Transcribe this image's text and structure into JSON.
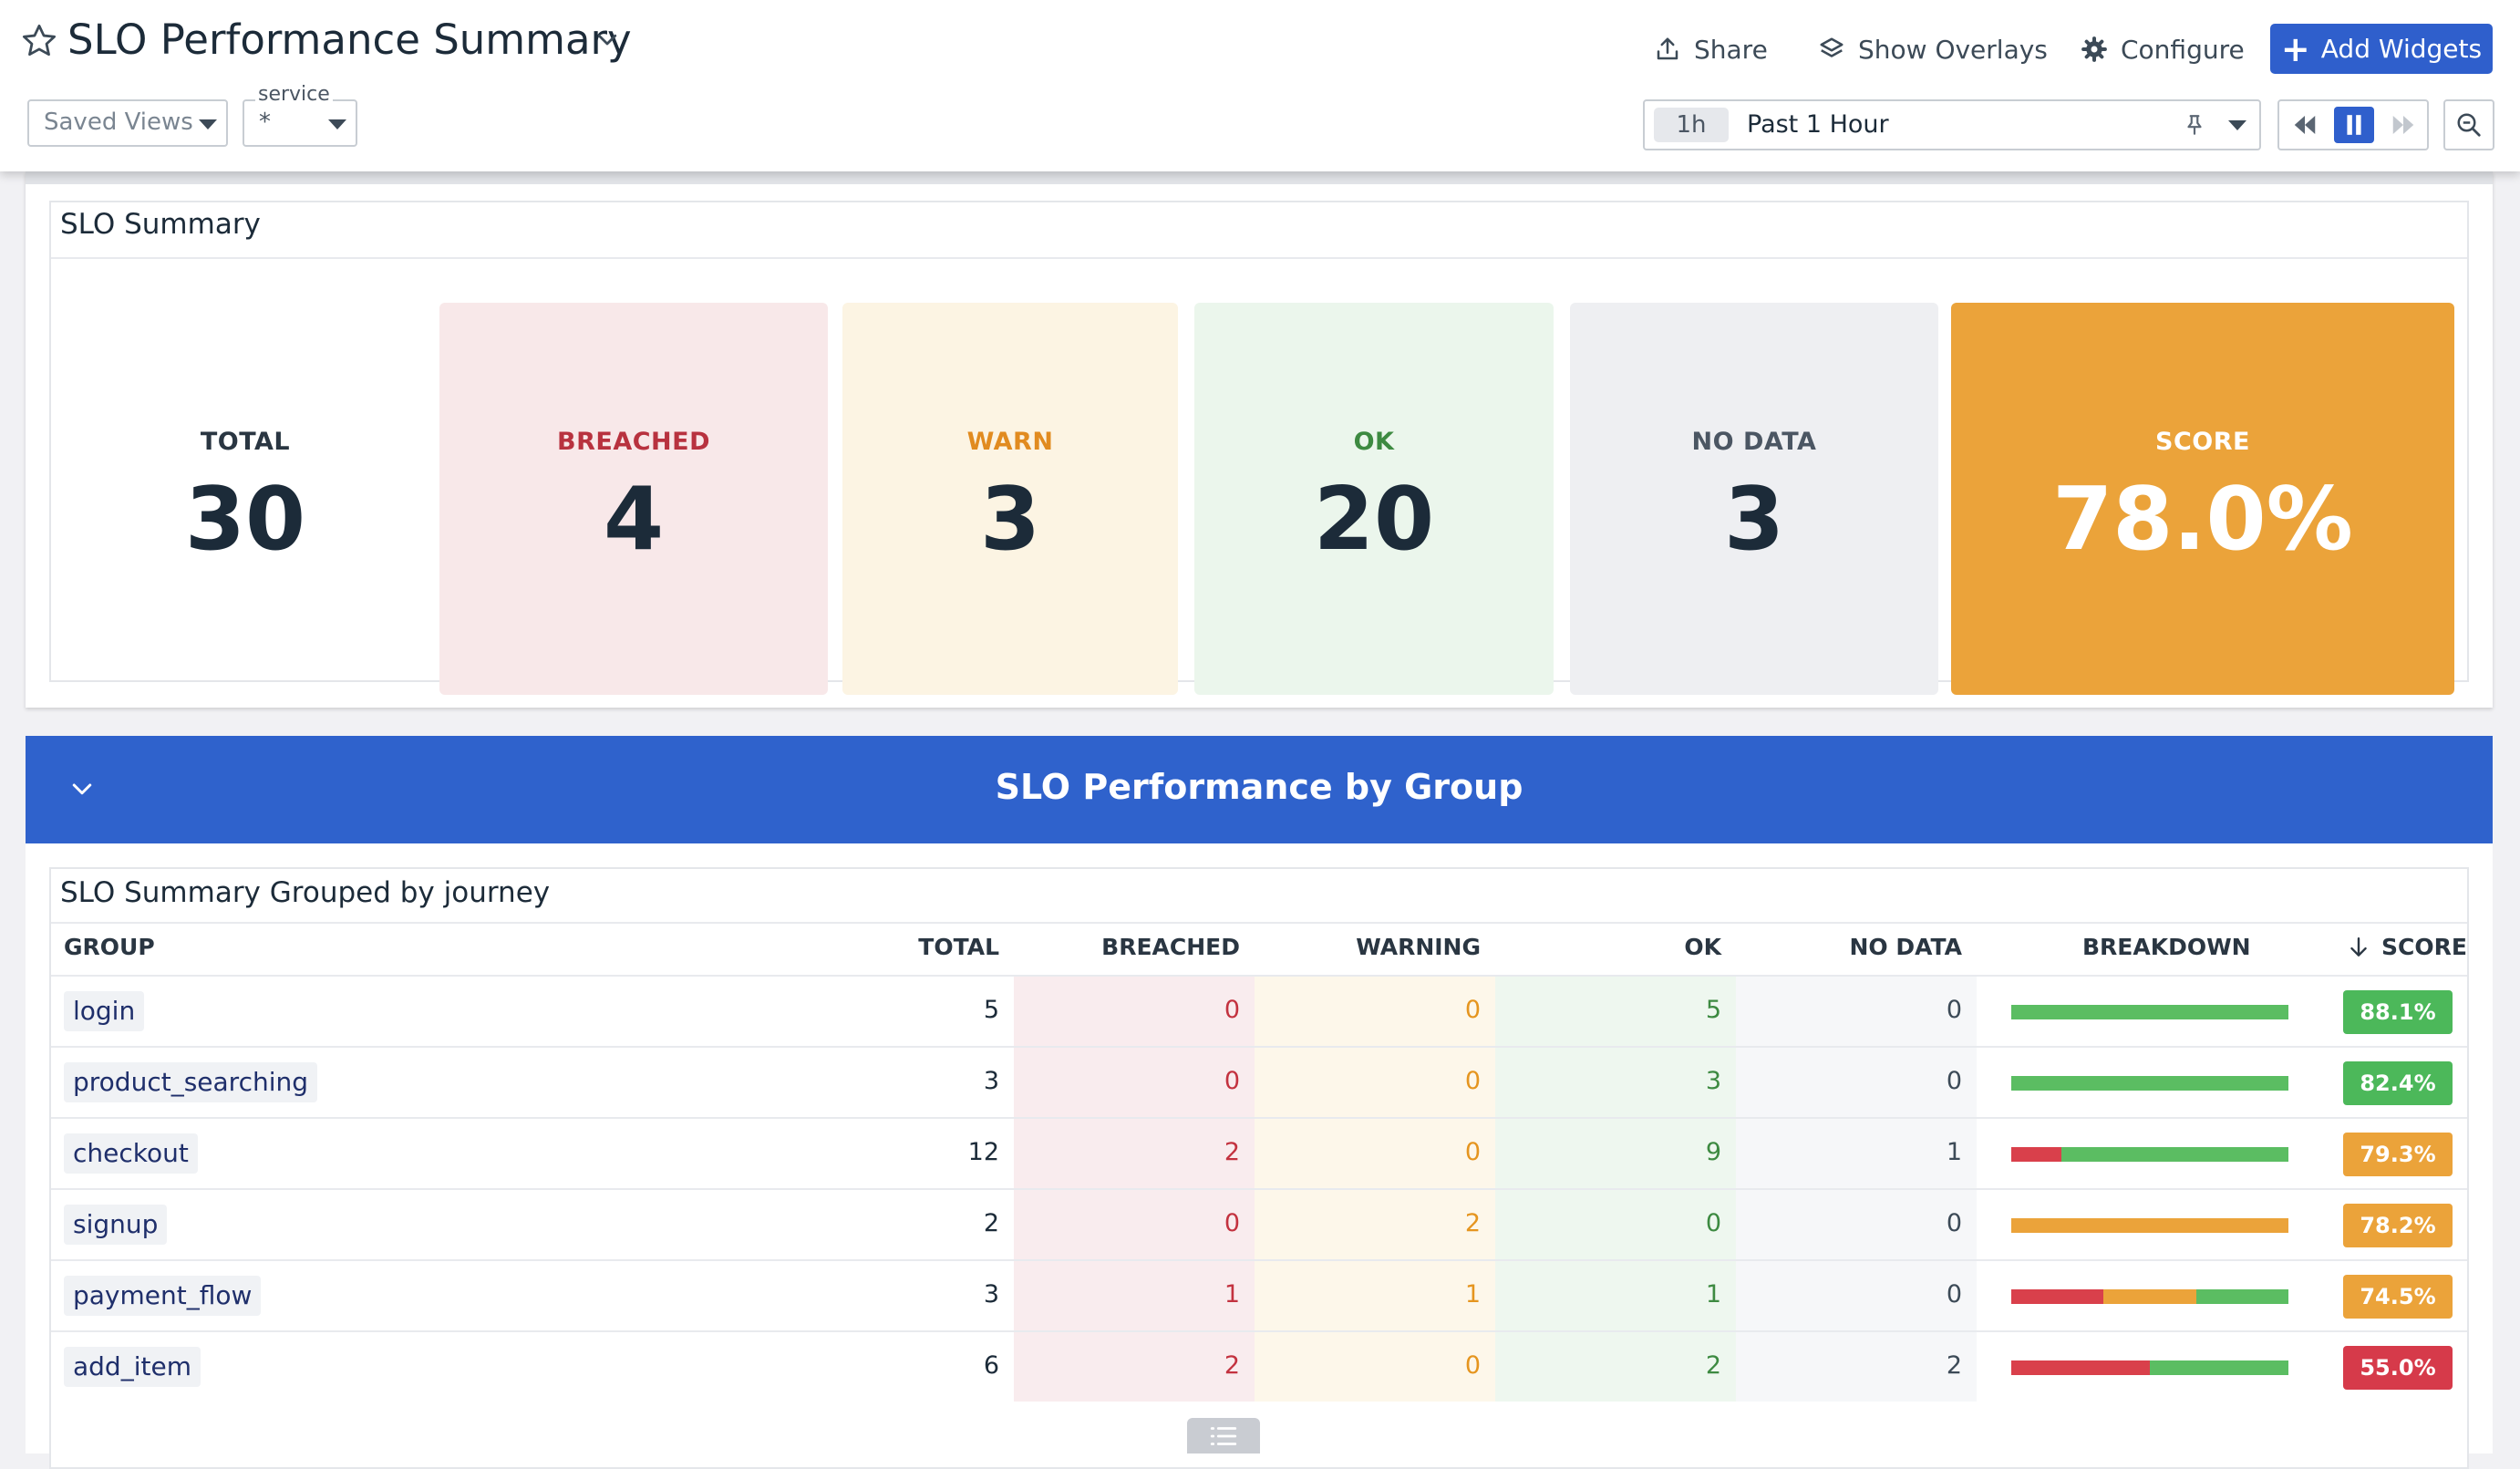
{
  "header": {
    "title": "SLO Performance Summary",
    "share_label": "Share",
    "overlays_label": "Show Overlays",
    "configure_label": "Configure",
    "add_widgets_label": "Add Widgets",
    "saved_views_label": "Saved Views",
    "service_filter": {
      "label": "service",
      "value": "*"
    },
    "time": {
      "badge": "1h",
      "label": "Past 1 Hour"
    }
  },
  "summary": {
    "title": "SLO Summary",
    "total": {
      "label": "TOTAL",
      "value": "30"
    },
    "breached": {
      "label": "BREACHED",
      "value": "4"
    },
    "warn": {
      "label": "WARN",
      "value": "3"
    },
    "ok": {
      "label": "OK",
      "value": "20"
    },
    "no_data": {
      "label": "NO DATA",
      "value": "3"
    },
    "score": {
      "label": "SCORE",
      "value": "78.0%"
    }
  },
  "group_section": {
    "banner_title": "SLO Performance by Group",
    "widget_title": "SLO Summary Grouped by journey",
    "columns": {
      "group": "GROUP",
      "total": "TOTAL",
      "breached": "BREACHED",
      "warning": "WARNING",
      "ok": "OK",
      "no_data": "NO DATA",
      "breakdown": "BREAKDOWN",
      "score": "SCORE"
    },
    "rows": [
      {
        "group": "login",
        "total": "5",
        "breached": "0",
        "warning": "0",
        "ok": "5",
        "no_data": "0",
        "score": "88.1%",
        "score_status": "ok"
      },
      {
        "group": "product_searching",
        "total": "3",
        "breached": "0",
        "warning": "0",
        "ok": "3",
        "no_data": "0",
        "score": "82.4%",
        "score_status": "ok"
      },
      {
        "group": "checkout",
        "total": "12",
        "breached": "2",
        "warning": "0",
        "ok": "9",
        "no_data": "1",
        "score": "79.3%",
        "score_status": "warn"
      },
      {
        "group": "signup",
        "total": "2",
        "breached": "0",
        "warning": "2",
        "ok": "0",
        "no_data": "0",
        "score": "78.2%",
        "score_status": "warn"
      },
      {
        "group": "payment_flow",
        "total": "3",
        "breached": "1",
        "warning": "1",
        "ok": "1",
        "no_data": "0",
        "score": "74.5%",
        "score_status": "warn"
      },
      {
        "group": "add_item",
        "total": "6",
        "breached": "2",
        "warning": "0",
        "ok": "2",
        "no_data": "2",
        "score": "55.0%",
        "score_status": "breached"
      }
    ]
  },
  "colors": {
    "accent": "#2f5fcc",
    "breached": "#d9404b",
    "warning": "#eba33a",
    "ok": "#5bbd62",
    "score_ok": "#4cb85a",
    "score_warn": "#eba33a",
    "score_breached": "#d63a4a"
  },
  "icons": {
    "favorite": "star-icon",
    "share": "upload-icon",
    "overlays": "layers-icon",
    "configure": "gear-icon",
    "add": "plus-icon",
    "collapse": "chevron-down-icon",
    "sort": "arrow-down-icon",
    "pin": "pin-icon",
    "zoom": "zoom-out-icon",
    "drag": "list-icon"
  }
}
